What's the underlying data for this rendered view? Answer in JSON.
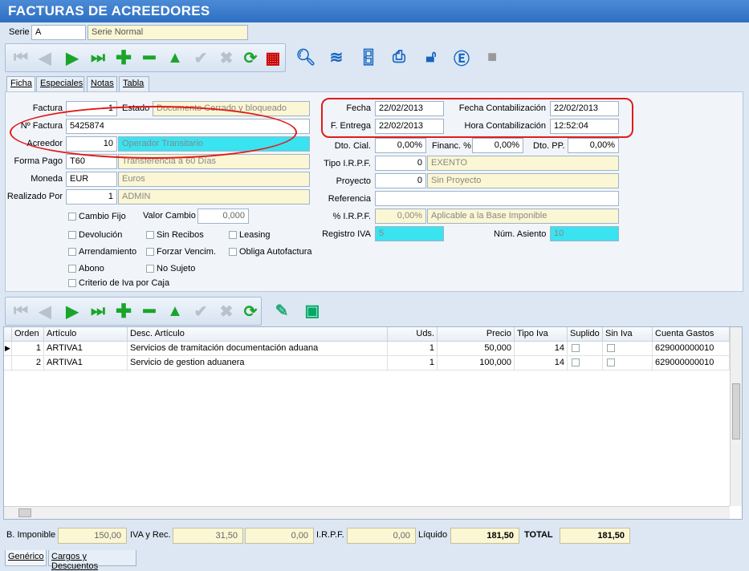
{
  "title": "FACTURAS DE ACREEDORES",
  "serie": {
    "label": "Serie",
    "code": "A",
    "name": "Serie Normal"
  },
  "tabs": [
    "Ficha",
    "Especiales",
    "Notas",
    "Tabla"
  ],
  "form": {
    "factura_label": "Factura",
    "factura": "1",
    "estado_label": "Estado",
    "estado": "Documento Cerrado y bloqueado",
    "nfactura_label": "Nº Factura",
    "nfactura": "5425874",
    "acreedor_label": "Acreedor",
    "acreedor_code": "10",
    "acreedor_name": "Operador Transitario",
    "formapago_label": "Forma Pago",
    "formapago_code": "T60",
    "formapago_name": "Transferencia a 60 Días",
    "moneda_label": "Moneda",
    "moneda_code": "EUR",
    "moneda_name": "Euros",
    "realizado_label": "Realizado Por",
    "realizado_code": "1",
    "realizado_name": "ADMIN",
    "cambiofijo": "Cambio Fijo",
    "valorcambio_label": "Valor Cambio",
    "valorcambio": "0,000",
    "devolucion": "Devolución",
    "sinrecibos": "Sin Recibos",
    "leasing": "Leasing",
    "arrendamiento": "Arrendamiento",
    "forzar": "Forzar Vencim.",
    "obliga": "Obliga Autofactura",
    "abono": "Abono",
    "nosujeto": "No Sujeto",
    "criterio": "Criterio de Iva por Caja",
    "fecha_label": "Fecha",
    "fecha": "22/02/2013",
    "fentrega_label": "F. Entrega",
    "fentrega": "22/02/2013",
    "fcont_label": "Fecha Contabilización",
    "fcont": "22/02/2013",
    "hcont_label": "Hora Contabilización",
    "hcont": "12:52:04",
    "dtocial_label": "Dto. Cial.",
    "dtocial": "0,00%",
    "financ_label": "Financ. %",
    "financ": "0,00%",
    "dtopp_label": "Dto. PP.",
    "dtopp": "0,00%",
    "tipoirpf_label": "Tipo I.R.P.F.",
    "tipoirpf_code": "0",
    "tipoirpf_name": "EXENTO",
    "proyecto_label": "Proyecto",
    "proyecto_code": "0",
    "proyecto_name": "Sin Proyecto",
    "referencia_label": "Referencia",
    "referencia": "",
    "pirpf_label": "% I.R.P.F.",
    "pirpf": "0,00%",
    "pirpf_desc": "Aplicable a la Base Imponible",
    "registroiva_label": "Registro IVA",
    "registroiva": "5",
    "numasiento_label": "Núm. Asiento",
    "numasiento": "10"
  },
  "grid": {
    "headers": [
      "Orden",
      "Artículo",
      "Desc. Artículo",
      "Uds.",
      "Precio",
      "Tipo Iva",
      "Suplido",
      "Sin Iva",
      "Cuenta Gastos"
    ],
    "rows": [
      {
        "orden": "1",
        "articulo": "ARTIVA1",
        "desc": "Servicios de tramitación documentación aduana",
        "uds": "1",
        "precio": "50,000",
        "tipoiva": "14",
        "cuenta": "629000000010"
      },
      {
        "orden": "2",
        "articulo": "ARTIVA1",
        "desc": "Servicio de gestion aduanera",
        "uds": "1",
        "precio": "100,000",
        "tipoiva": "14",
        "cuenta": "629000000010"
      }
    ]
  },
  "totals": {
    "bimp_label": "B. Imponible",
    "bimp": "150,00",
    "iva_label": "IVA y Rec.",
    "iva": "31,50",
    "rec": "0,00",
    "irpf_label": "I.R.P.F.",
    "irpf": "0,00",
    "liquido_label": "Líquido",
    "liquido": "181,50",
    "total_label": "TOTAL",
    "total": "181,50"
  },
  "bottom_tabs": [
    "Genérico",
    "Cargos y Descuentos"
  ]
}
